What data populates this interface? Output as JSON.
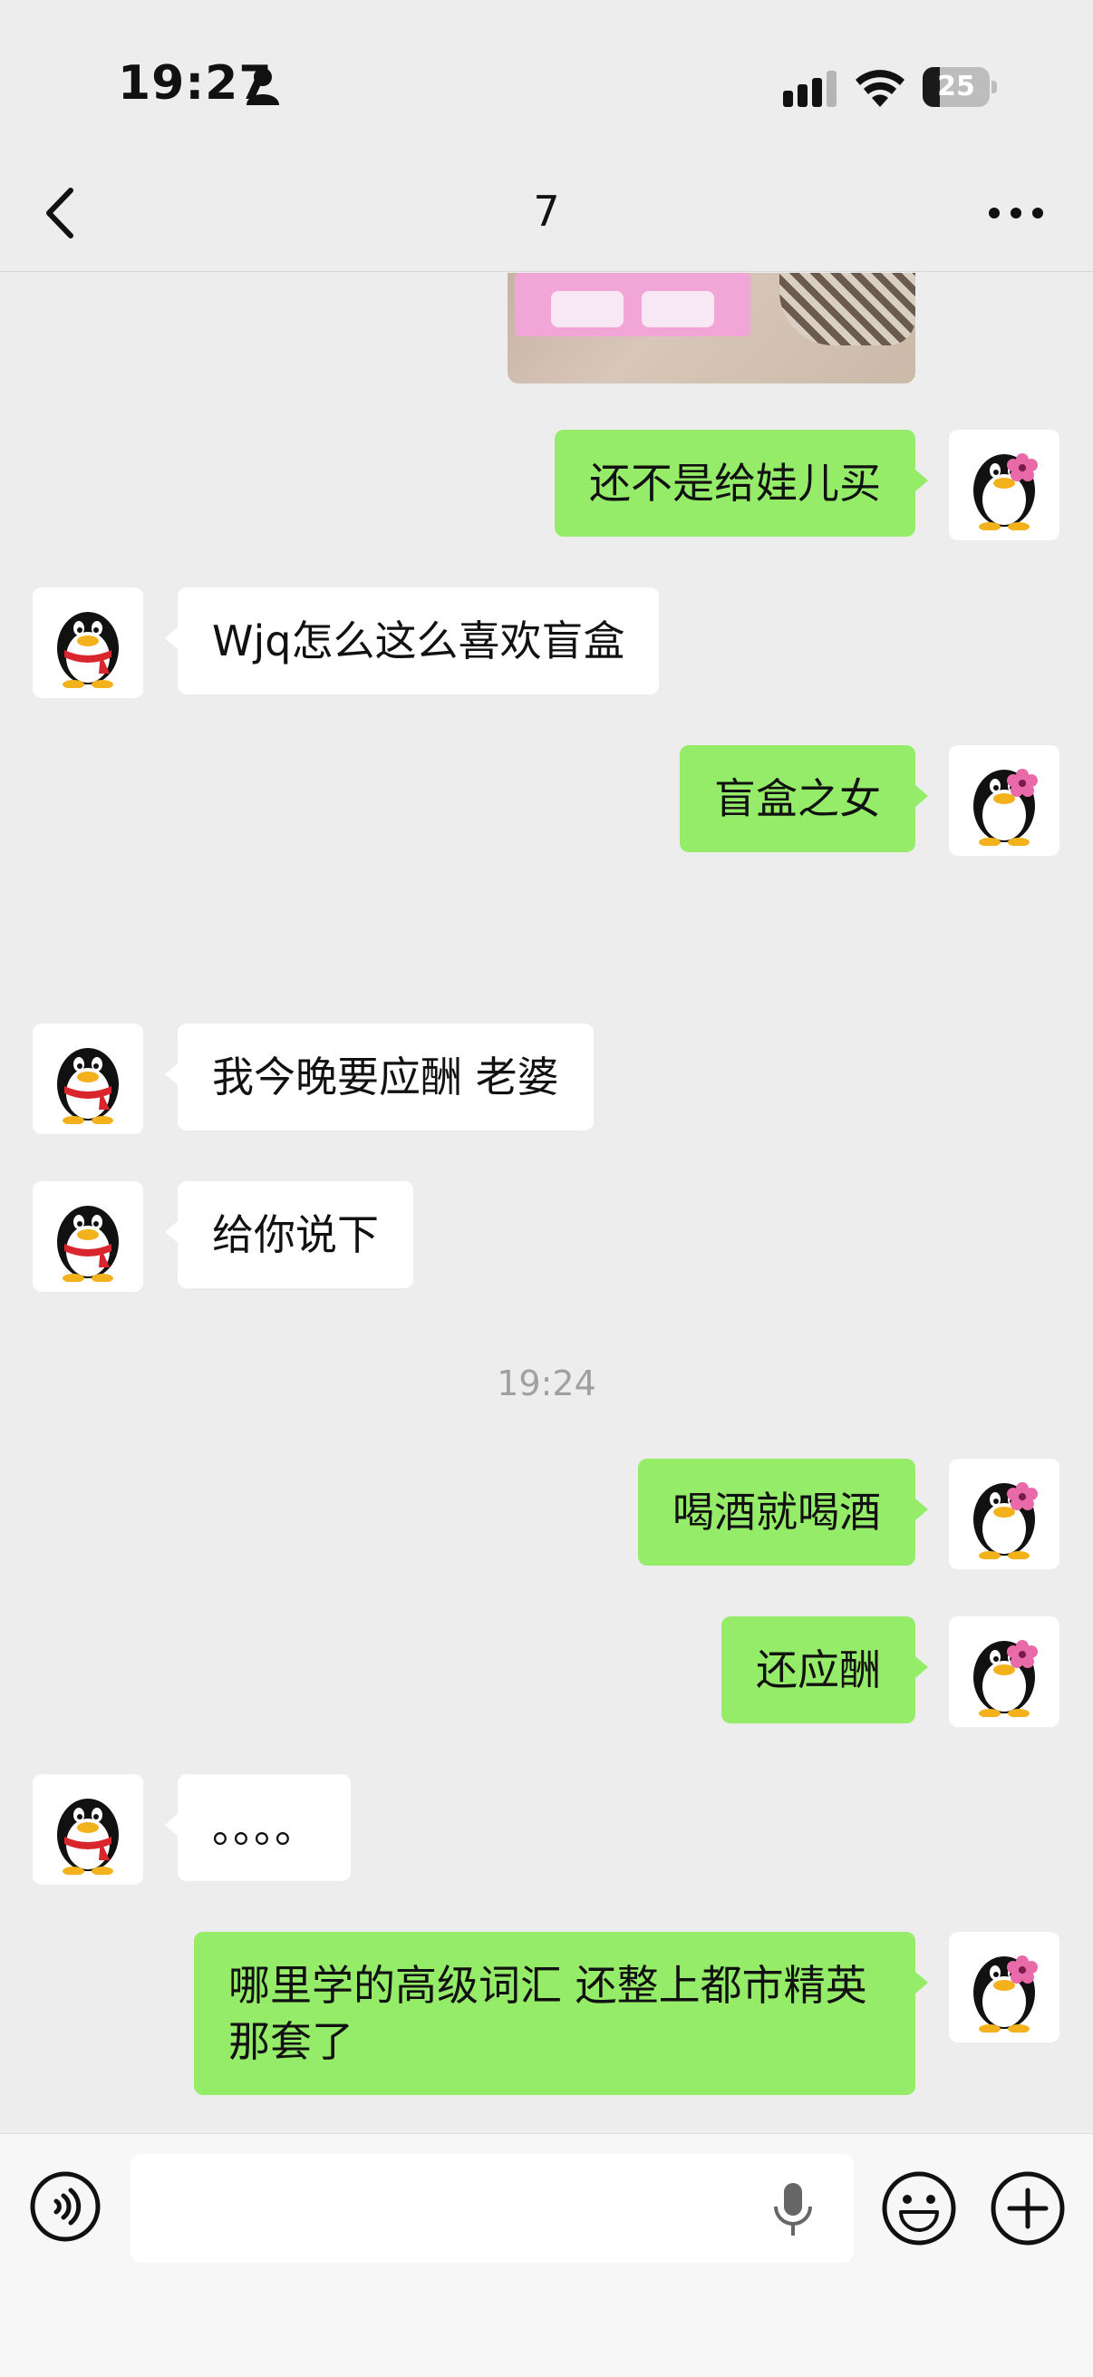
{
  "status_bar": {
    "time": "19:27",
    "battery_level": "25",
    "battery_fraction": 0.25,
    "icons": [
      "person-icon",
      "signal-icon",
      "wifi-icon",
      "battery-icon"
    ]
  },
  "nav": {
    "title": "7",
    "back_icon": "chevron-left-icon",
    "more_icon": "more-dots-icon"
  },
  "colors": {
    "background": "#ededed",
    "outgoing_bubble": "#95ec69",
    "incoming_bubble": "#ffffff",
    "timestamp_text": "#a0a0a0"
  },
  "messages": [
    {
      "side": "out",
      "text": "还不是给娃儿买"
    },
    {
      "side": "in",
      "text": "Wjq怎么这么喜欢盲盒"
    },
    {
      "side": "out",
      "text": "盲盒之女"
    },
    {
      "side": "in",
      "text": "我今晚要应酬 老婆"
    },
    {
      "side": "in",
      "text": "给你说下"
    },
    {
      "type": "time",
      "text": "19:24"
    },
    {
      "side": "out",
      "text": "喝酒就喝酒"
    },
    {
      "side": "out",
      "text": "还应酬"
    },
    {
      "side": "in",
      "text": "。。。。"
    },
    {
      "side": "out",
      "text": "哪里学的高级词汇 还整上都市精英那套了"
    }
  ],
  "input_bar": {
    "value": "",
    "icons": [
      "voice-icon",
      "mic-icon",
      "emoji-icon",
      "plus-icon"
    ]
  }
}
